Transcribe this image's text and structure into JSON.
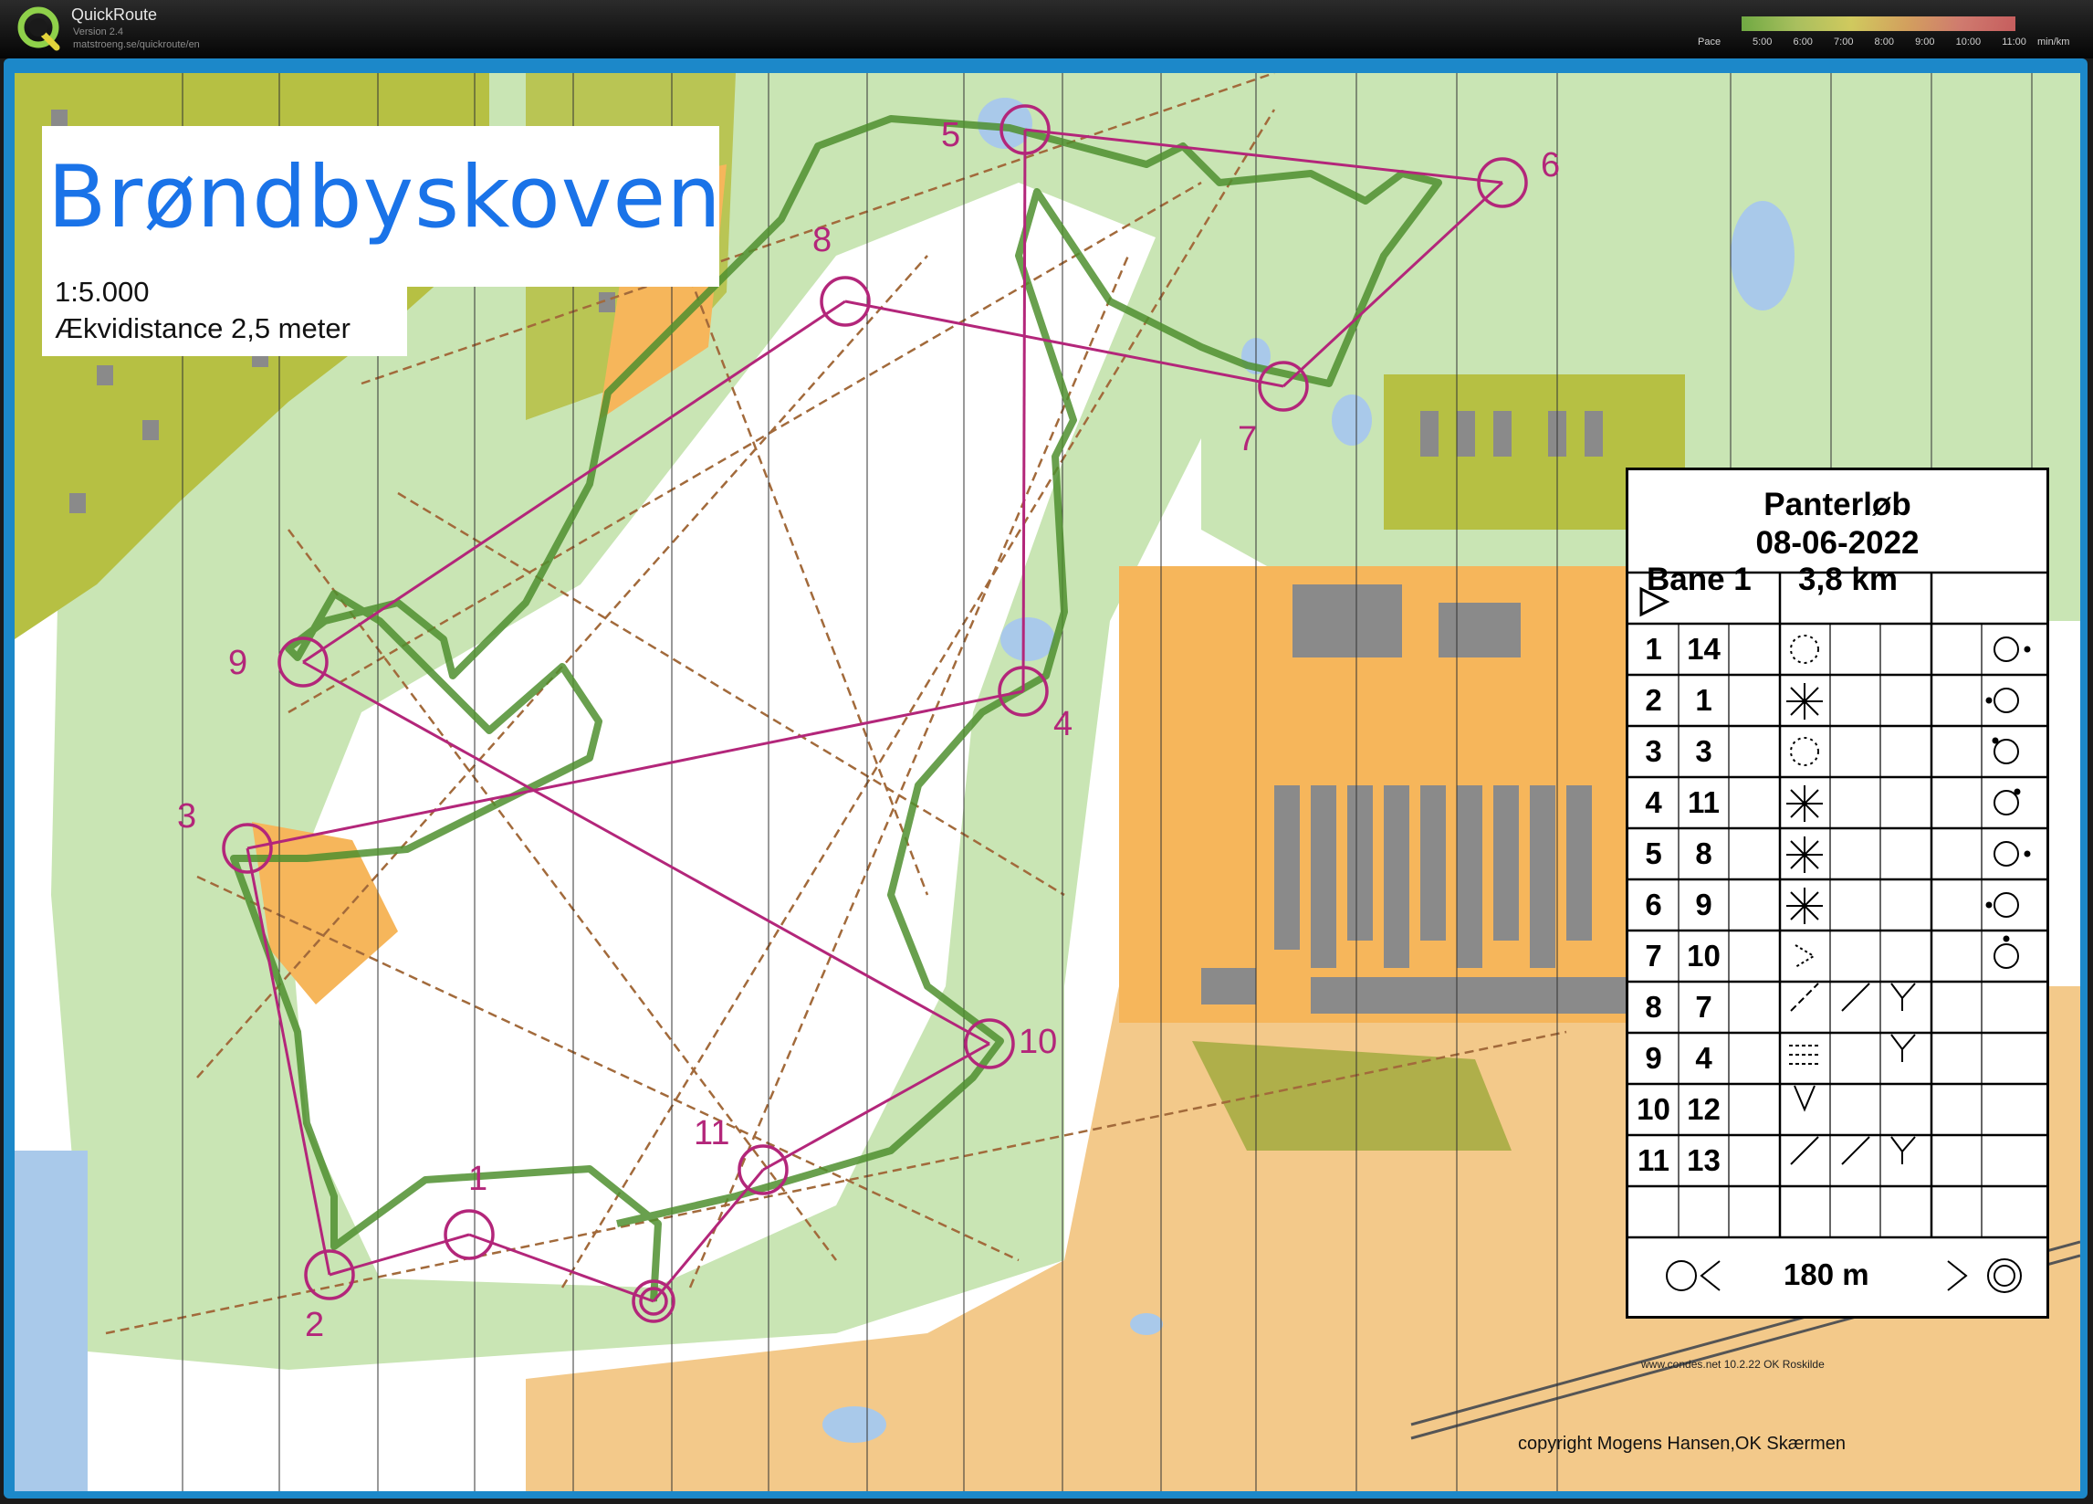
{
  "app": {
    "name": "QuickRoute",
    "version": "Version 2.4",
    "url": "matstroeng.se/quickroute/en",
    "pace_label": "Pace",
    "pace_ticks": [
      "5:00",
      "6:00",
      "7:00",
      "8:00",
      "9:00",
      "10:00",
      "11:00"
    ],
    "pace_unit": "min/km"
  },
  "map": {
    "title": "Brøndbyskoven",
    "scale": "1:5.000",
    "contour_interval": "Ækvidistance 2,5 meter",
    "copyright": "copyright Mogens Hansen,OK Skærmen",
    "condes_credit": "www.condes.net 10.2.22 OK Roskilde",
    "controls": [
      {
        "label": "1"
      },
      {
        "label": "2"
      },
      {
        "label": "3"
      },
      {
        "label": "4"
      },
      {
        "label": "5"
      },
      {
        "label": "6"
      },
      {
        "label": "7"
      },
      {
        "label": "8"
      },
      {
        "label": "9"
      },
      {
        "label": "10"
      },
      {
        "label": "11"
      }
    ]
  },
  "description": {
    "event": "Panterløb",
    "date": "08-06-2022",
    "course": "Bane 1",
    "length": "3,8 km",
    "finish_distance": "180 m",
    "rows": [
      {
        "no": "1",
        "code": "14"
      },
      {
        "no": "2",
        "code": "1"
      },
      {
        "no": "3",
        "code": "3"
      },
      {
        "no": "4",
        "code": "11"
      },
      {
        "no": "5",
        "code": "8"
      },
      {
        "no": "6",
        "code": "9"
      },
      {
        "no": "7",
        "code": "10"
      },
      {
        "no": "8",
        "code": "7"
      },
      {
        "no": "9",
        "code": "4"
      },
      {
        "no": "10",
        "code": "12"
      },
      {
        "no": "11",
        "code": "13"
      }
    ]
  },
  "colors": {
    "accent": "#1c88c9",
    "course": "#b3267a",
    "route": "#4f8f2f",
    "forest": "#c9e5b4",
    "open": "#f6b65b",
    "urban": "#b6c043",
    "water": "#a9c9ea"
  }
}
